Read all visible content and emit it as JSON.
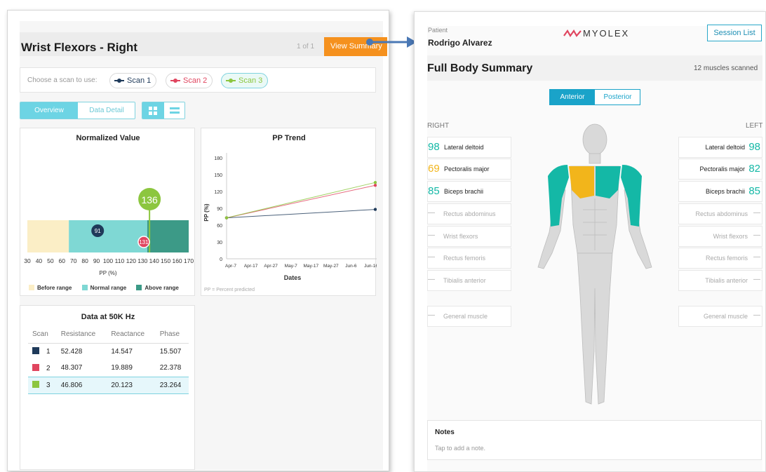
{
  "left": {
    "title": "Wrist Flexors - Right",
    "page_counter": "1 of 1",
    "view_summary_label": "View Summary",
    "scan_prompt": "Choose a scan to use:",
    "scans": [
      {
        "label": "Scan 1",
        "color": "#1f3a5a"
      },
      {
        "label": "Scan 2",
        "color": "#e0455f"
      },
      {
        "label": "Scan 3",
        "color": "#8cc63f"
      }
    ],
    "tabs": [
      "Overview",
      "Data Detail"
    ],
    "normalized": {
      "title": "Normalized Value",
      "x_ticks": [
        "30",
        "40",
        "50",
        "60",
        "70",
        "80",
        "90",
        "100",
        "110",
        "120",
        "130",
        "140",
        "150",
        "160",
        "170"
      ],
      "x_label": "PP (%)",
      "values": {
        "scan1": 91,
        "scan2": 131,
        "scan3": 136
      },
      "legend": [
        "Before range",
        "Normal range",
        "Above range"
      ],
      "colors": {
        "before": "#fbeec6",
        "normal": "#7fd8d4",
        "above": "#3c9a87"
      }
    },
    "trend": {
      "title": "PP Trend",
      "y_label": "PP (%)",
      "x_label": "Dates",
      "y_ticks": [
        "0",
        "30",
        "60",
        "90",
        "120",
        "150",
        "180"
      ],
      "x_ticks": [
        "Apr-7",
        "Apr-17",
        "Apr-27",
        "May-7",
        "May-17",
        "May-27",
        "Jun-6",
        "Jun-16"
      ],
      "footnote": "PP = Percent predicted"
    },
    "table": {
      "title": "Data at 50K Hz",
      "headers": [
        "Scan",
        "Resistance",
        "Reactance",
        "Phase"
      ],
      "rows": [
        {
          "scan": "1",
          "resistance": "52.428",
          "reactance": "14.547",
          "phase": "15.507"
        },
        {
          "scan": "2",
          "resistance": "48.307",
          "reactance": "19.889",
          "phase": "22.378"
        },
        {
          "scan": "3",
          "resistance": "46.806",
          "reactance": "20.123",
          "phase": "23.264"
        }
      ]
    }
  },
  "chart_data": [
    {
      "type": "bar",
      "title": "Normalized Value",
      "xlabel": "PP (%)",
      "xlim": [
        30,
        170
      ],
      "ranges": [
        {
          "name": "Before range",
          "from": 30,
          "to": 66
        },
        {
          "name": "Normal range",
          "from": 66,
          "to": 134
        },
        {
          "name": "Above range",
          "from": 134,
          "to": 170
        }
      ],
      "markers": [
        {
          "name": "Scan 1",
          "value": 91
        },
        {
          "name": "Scan 2",
          "value": 131
        },
        {
          "name": "Scan 3",
          "value": 136
        }
      ]
    },
    {
      "type": "line",
      "title": "PP Trend",
      "xlabel": "Dates",
      "ylabel": "PP (%)",
      "ylim": [
        0,
        180
      ],
      "x": [
        "Apr-7",
        "Jun-16"
      ],
      "series": [
        {
          "name": "Scan 1",
          "values": [
            73,
            88
          ]
        },
        {
          "name": "Scan 2",
          "values": [
            73,
            131
          ]
        },
        {
          "name": "Scan 3",
          "values": [
            73,
            136
          ]
        }
      ]
    }
  ],
  "right": {
    "patient_label": "Patient",
    "patient_name": "Rodrigo Alvarez",
    "brand": "MYOLEX",
    "session_list_label": "Session List",
    "title": "Full Body Summary",
    "muscles_count": "12 muscles scanned",
    "view_tabs": [
      "Anterior",
      "Posterior"
    ],
    "side_right": "RIGHT",
    "side_left": "LEFT",
    "right_muscles": [
      {
        "score": "98",
        "name": "Lateral deltoid",
        "color": "#14b8a6"
      },
      {
        "score": "69",
        "name": "Pectoralis major",
        "color": "#f2b51b"
      },
      {
        "score": "85",
        "name": "Biceps brachii",
        "color": "#14b8a6"
      },
      {
        "score": "—",
        "name": "Rectus abdominus"
      },
      {
        "score": "—",
        "name": "Wrist flexors"
      },
      {
        "score": "—",
        "name": "Rectus femoris"
      },
      {
        "score": "—",
        "name": "Tibialis anterior"
      },
      {
        "score": "—",
        "name": "General muscle"
      }
    ],
    "left_muscles": [
      {
        "score": "98",
        "name": "Lateral deltoid",
        "color": "#14b8a6"
      },
      {
        "score": "82",
        "name": "Pectoralis major",
        "color": "#14b8a6"
      },
      {
        "score": "85",
        "name": "Biceps brachii",
        "color": "#14b8a6"
      },
      {
        "score": "—",
        "name": "Rectus abdominus"
      },
      {
        "score": "—",
        "name": "Wrist flexors"
      },
      {
        "score": "—",
        "name": "Rectus femoris"
      },
      {
        "score": "—",
        "name": "Tibialis anterior"
      },
      {
        "score": "—",
        "name": "General muscle"
      }
    ],
    "notes_title": "Notes",
    "notes_placeholder": "Tap to add a note."
  }
}
